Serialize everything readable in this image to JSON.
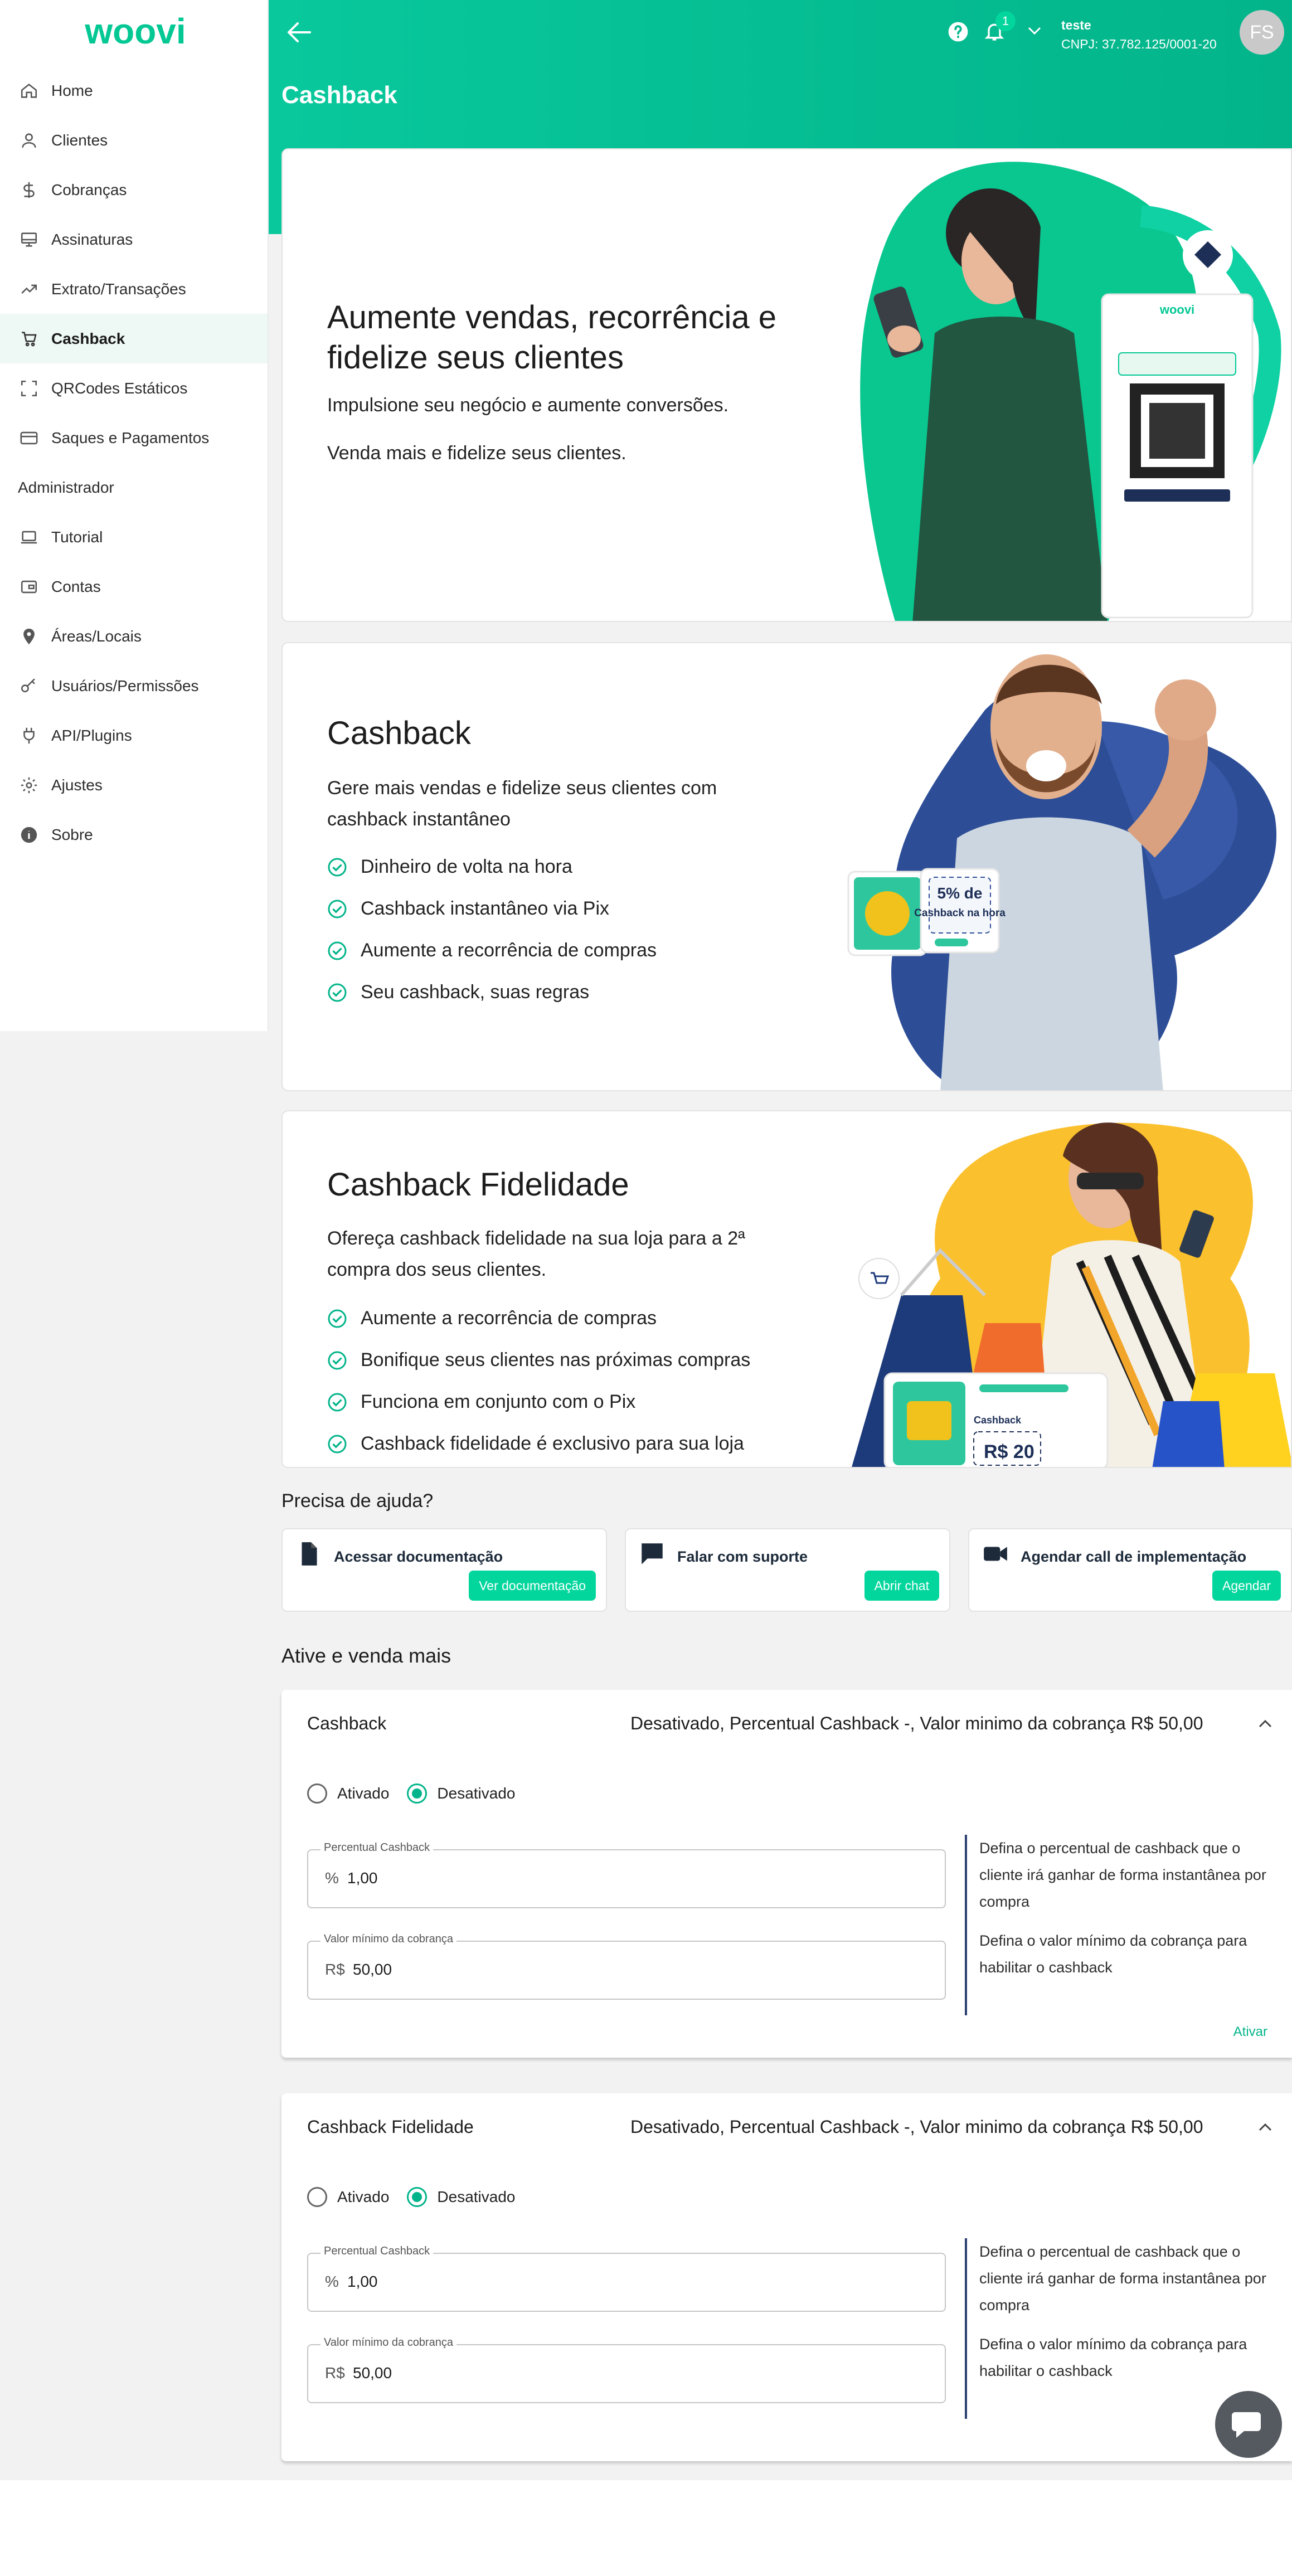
{
  "app": {
    "brand": "woovi",
    "page_title": "Cashback"
  },
  "colors": {
    "brand": "#03d69d",
    "header_start": "#08c89c",
    "header_end": "#03b48a",
    "nav_dark": "#2a4070"
  },
  "sidebar": {
    "items": [
      {
        "label": "Home",
        "icon": "home-icon"
      },
      {
        "label": "Clientes",
        "icon": "user-icon"
      },
      {
        "label": "Cobranças",
        "icon": "dollar-icon"
      },
      {
        "label": "Assinaturas",
        "icon": "monitor-icon"
      },
      {
        "label": "Extrato/Transações",
        "icon": "trend-icon"
      },
      {
        "label": "Cashback",
        "icon": "cart-icon",
        "active": true
      },
      {
        "label": "QRCodes Estáticos",
        "icon": "qr-frame-icon"
      },
      {
        "label": "Saques e Pagamentos",
        "icon": "card-icon"
      }
    ],
    "section_label": "Administrador",
    "admin_items": [
      {
        "label": "Tutorial",
        "icon": "laptop-icon"
      },
      {
        "label": "Contas",
        "icon": "wallet-icon"
      },
      {
        "label": "Áreas/Locais",
        "icon": "pin-icon"
      },
      {
        "label": "Usuários/Permissões",
        "icon": "key-icon"
      },
      {
        "label": "API/Plugins",
        "icon": "plug-icon"
      },
      {
        "label": "Ajustes",
        "icon": "gear-icon"
      },
      {
        "label": "Sobre",
        "icon": "info-icon"
      }
    ]
  },
  "header": {
    "notifications": "1",
    "user_name": "teste",
    "user_doc": "CNPJ: 37.782.125/0001-20",
    "avatar_initials": "FS"
  },
  "cards": {
    "hero": {
      "title": "Aumente vendas, recorrência e fidelize seus clientes",
      "p1": "Impulsione seu negócio e aumente conversões.",
      "p2": "Venda mais e fidelize seus clientes."
    },
    "cashback": {
      "title": "Cashback",
      "desc": "Gere mais vendas e fidelize seus clientes com cashback instantâneo",
      "bullets": [
        "Dinheiro de volta na hora",
        "Cashback instantâneo via Pix",
        "Aumente a recorrência de compras",
        "Seu cashback, suas regras"
      ],
      "badge": "5% de Cashback na hora"
    },
    "fidelidade": {
      "title": "Cashback Fidelidade",
      "desc": "Ofereça cashback fidelidade na sua loja para a 2ª compra dos seus clientes.",
      "bullets": [
        "Aumente a recorrência de compras",
        "Bonifique seus clientes nas próximas compras",
        "Funciona em conjunto com o Pix",
        "Cashback fidelidade é exclusivo para sua loja"
      ],
      "badge_title": "Cashback",
      "badge_value": "R$ 20"
    }
  },
  "help": {
    "title": "Precisa de ajuda?",
    "items": [
      {
        "title": "Acessar documentação",
        "button": "Ver documentação",
        "icon": "document-icon"
      },
      {
        "title": "Falar com suporte",
        "button": "Abrir chat",
        "icon": "chat-icon"
      },
      {
        "title": "Agendar call de implementação",
        "button": "Agendar",
        "icon": "video-icon"
      }
    ]
  },
  "ative_title": "Ative e venda mais",
  "panels": [
    {
      "title": "Cashback",
      "summary": "Desativado, Percentual Cashback -, Valor minimo da cobrança R$ 50,00",
      "radio_on": "Ativado",
      "radio_off": "Desativado",
      "selected": "Desativado",
      "percent_label": "Percentual Cashback",
      "percent_prefix": "%",
      "percent_value": "1,00",
      "min_label": "Valor mínimo da cobrança",
      "min_prefix": "R$",
      "min_value": "50,00",
      "help1": "Defina o percentual de cashback que o cliente irá ganhar de forma instantânea por compra",
      "help2": "Defina o valor mínimo da cobrança para habilitar o cashback",
      "action": "Ativar"
    },
    {
      "title": "Cashback Fidelidade",
      "summary": "Desativado, Percentual Cashback -, Valor minimo da cobrança R$ 50,00",
      "radio_on": "Ativado",
      "radio_off": "Desativado",
      "selected": "Desativado",
      "percent_label": "Percentual Cashback",
      "percent_prefix": "%",
      "percent_value": "1,00",
      "min_label": "Valor mínimo da cobrança",
      "min_prefix": "R$",
      "min_value": "50,00",
      "help1": "Defina o percentual de cashback que o cliente irá ganhar de forma instantânea por compra",
      "help2": "Defina o valor mínimo da cobrança para habilitar o cashback"
    }
  ]
}
